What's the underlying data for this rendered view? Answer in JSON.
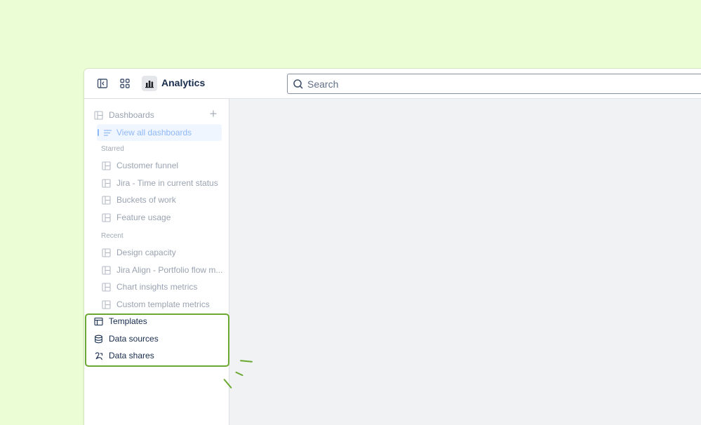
{
  "header": {
    "app_title": "Analytics",
    "search_placeholder": "Search",
    "icons": [
      "sidebar-toggle-icon",
      "app-switcher-icon",
      "analytics-logo-icon",
      "search-icon"
    ]
  },
  "sidebar": {
    "dashboards_label": "Dashboards",
    "view_all_label": "View all dashboards",
    "starred_label": "Starred",
    "starred": [
      "Customer funnel",
      "Jira - Time in current status",
      "Buckets of work",
      "Feature usage"
    ],
    "recent_label": "Recent",
    "recent": [
      "Design capacity",
      "Jira Align - Portfolio flow m...",
      "Chart insights metrics",
      "Custom template metrics"
    ],
    "templates_label": "Templates",
    "data_sources_label": "Data sources",
    "data_shares_label": "Data shares"
  },
  "colors": {
    "background": "#ebfdd4",
    "highlight": "#6aa82f",
    "active_text": "#172b4d",
    "muted_text": "#9aa3b1",
    "link_blue": "#8fb8f6"
  }
}
